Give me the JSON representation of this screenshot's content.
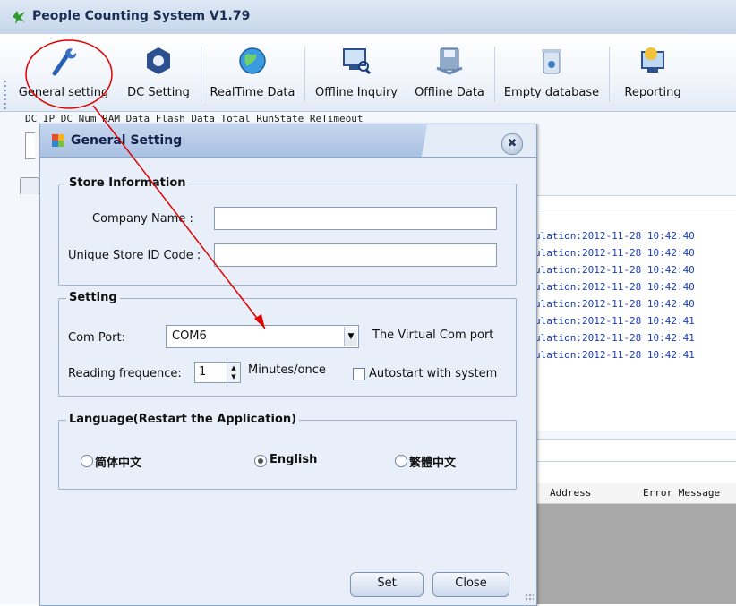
{
  "app": {
    "title": "People Counting System V1.79"
  },
  "toolbar": {
    "items": [
      {
        "label": "General setting",
        "icon": "wrench-icon"
      },
      {
        "label": "DC Setting",
        "icon": "hex-nut-icon"
      },
      {
        "label": "RealTime Data",
        "icon": "globe-icon"
      },
      {
        "label": "Offline Inquiry",
        "icon": "monitor-search-icon"
      },
      {
        "label": "Offline Data",
        "icon": "disk-icon"
      },
      {
        "label": "Empty database",
        "icon": "trash-icon"
      },
      {
        "label": "Reporting",
        "icon": "report-icon"
      }
    ]
  },
  "background": {
    "dc_header": "DC IP    DC Num   RAM Data  Flash Data Total          RunState    ReTimeout",
    "log_lines": [
      "ulation:2012-11-28 10:42:40",
      "ulation:2012-11-28 10:42:40",
      "ulation:2012-11-28 10:42:40",
      "ulation:2012-11-28 10:42:40",
      "ulation:2012-11-28 10:42:40",
      "ulation:2012-11-28 10:42:41",
      "ulation:2012-11-28 10:42:41",
      "ulation:2012-11-28 10:42:41"
    ],
    "error_table": {
      "address_header": "Address",
      "error_header": "Error Message"
    }
  },
  "dialog": {
    "title": "General Setting",
    "close_glyph": "✖",
    "store": {
      "legend": "Store Information",
      "company_label": "Company Name :",
      "company_value": "",
      "store_id_label": "Unique Store ID Code :",
      "store_id_value": ""
    },
    "setting": {
      "legend": "Setting",
      "com_port_label": "Com Port:",
      "com_port_value": "COM6",
      "com_port_hint": "The Virtual Com port",
      "reading_label": "Reading frequence:",
      "reading_value": "1",
      "reading_unit": "Minutes/once",
      "autostart_label": "Autostart with system",
      "autostart_checked": false
    },
    "language": {
      "legend": "Language(Restart the Application)",
      "options": [
        {
          "label": "简体中文",
          "selected": false
        },
        {
          "label": "English",
          "selected": true
        },
        {
          "label": "繁體中文",
          "selected": false
        }
      ]
    },
    "buttons": {
      "set": "Set",
      "close": "Close"
    }
  },
  "colors": {
    "annotation": "#e00000",
    "log_text": "#1a3fb0"
  }
}
